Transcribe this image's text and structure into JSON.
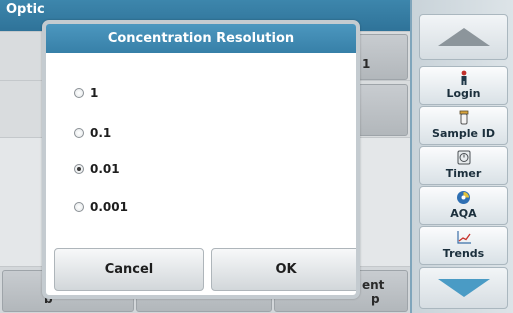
{
  "background": {
    "title_fragment": "Optic",
    "row1_value_fragment": "1",
    "bottom_fragment_1": "ent",
    "bottom_fragment_2": "p",
    "bottom_fragment_3": "b"
  },
  "dialog": {
    "title": "Concentration Resolution",
    "options": [
      {
        "label": "1",
        "selected": false
      },
      {
        "label": "0.1",
        "selected": false
      },
      {
        "label": "0.01",
        "selected": true
      },
      {
        "label": "0.001",
        "selected": false
      }
    ],
    "cancel_label": "Cancel",
    "ok_label": "OK"
  },
  "sidebar": {
    "scroll_up_icon": "triangle-up-icon",
    "items": [
      {
        "label": "Login",
        "icon": "person-icon"
      },
      {
        "label": "Sample ID",
        "icon": "vial-icon"
      },
      {
        "label": "Timer",
        "icon": "timer-icon"
      },
      {
        "label": "AQA",
        "icon": "aqa-icon"
      },
      {
        "label": "Trends",
        "icon": "trend-chart-icon"
      }
    ],
    "scroll_down_icon": "triangle-down-icon"
  },
  "colors": {
    "header_blue": "#3780a8",
    "sidebar_border": "#7fa5bb",
    "arrow_gray": "#8c959b",
    "arrow_blue": "#4a9bc5"
  }
}
